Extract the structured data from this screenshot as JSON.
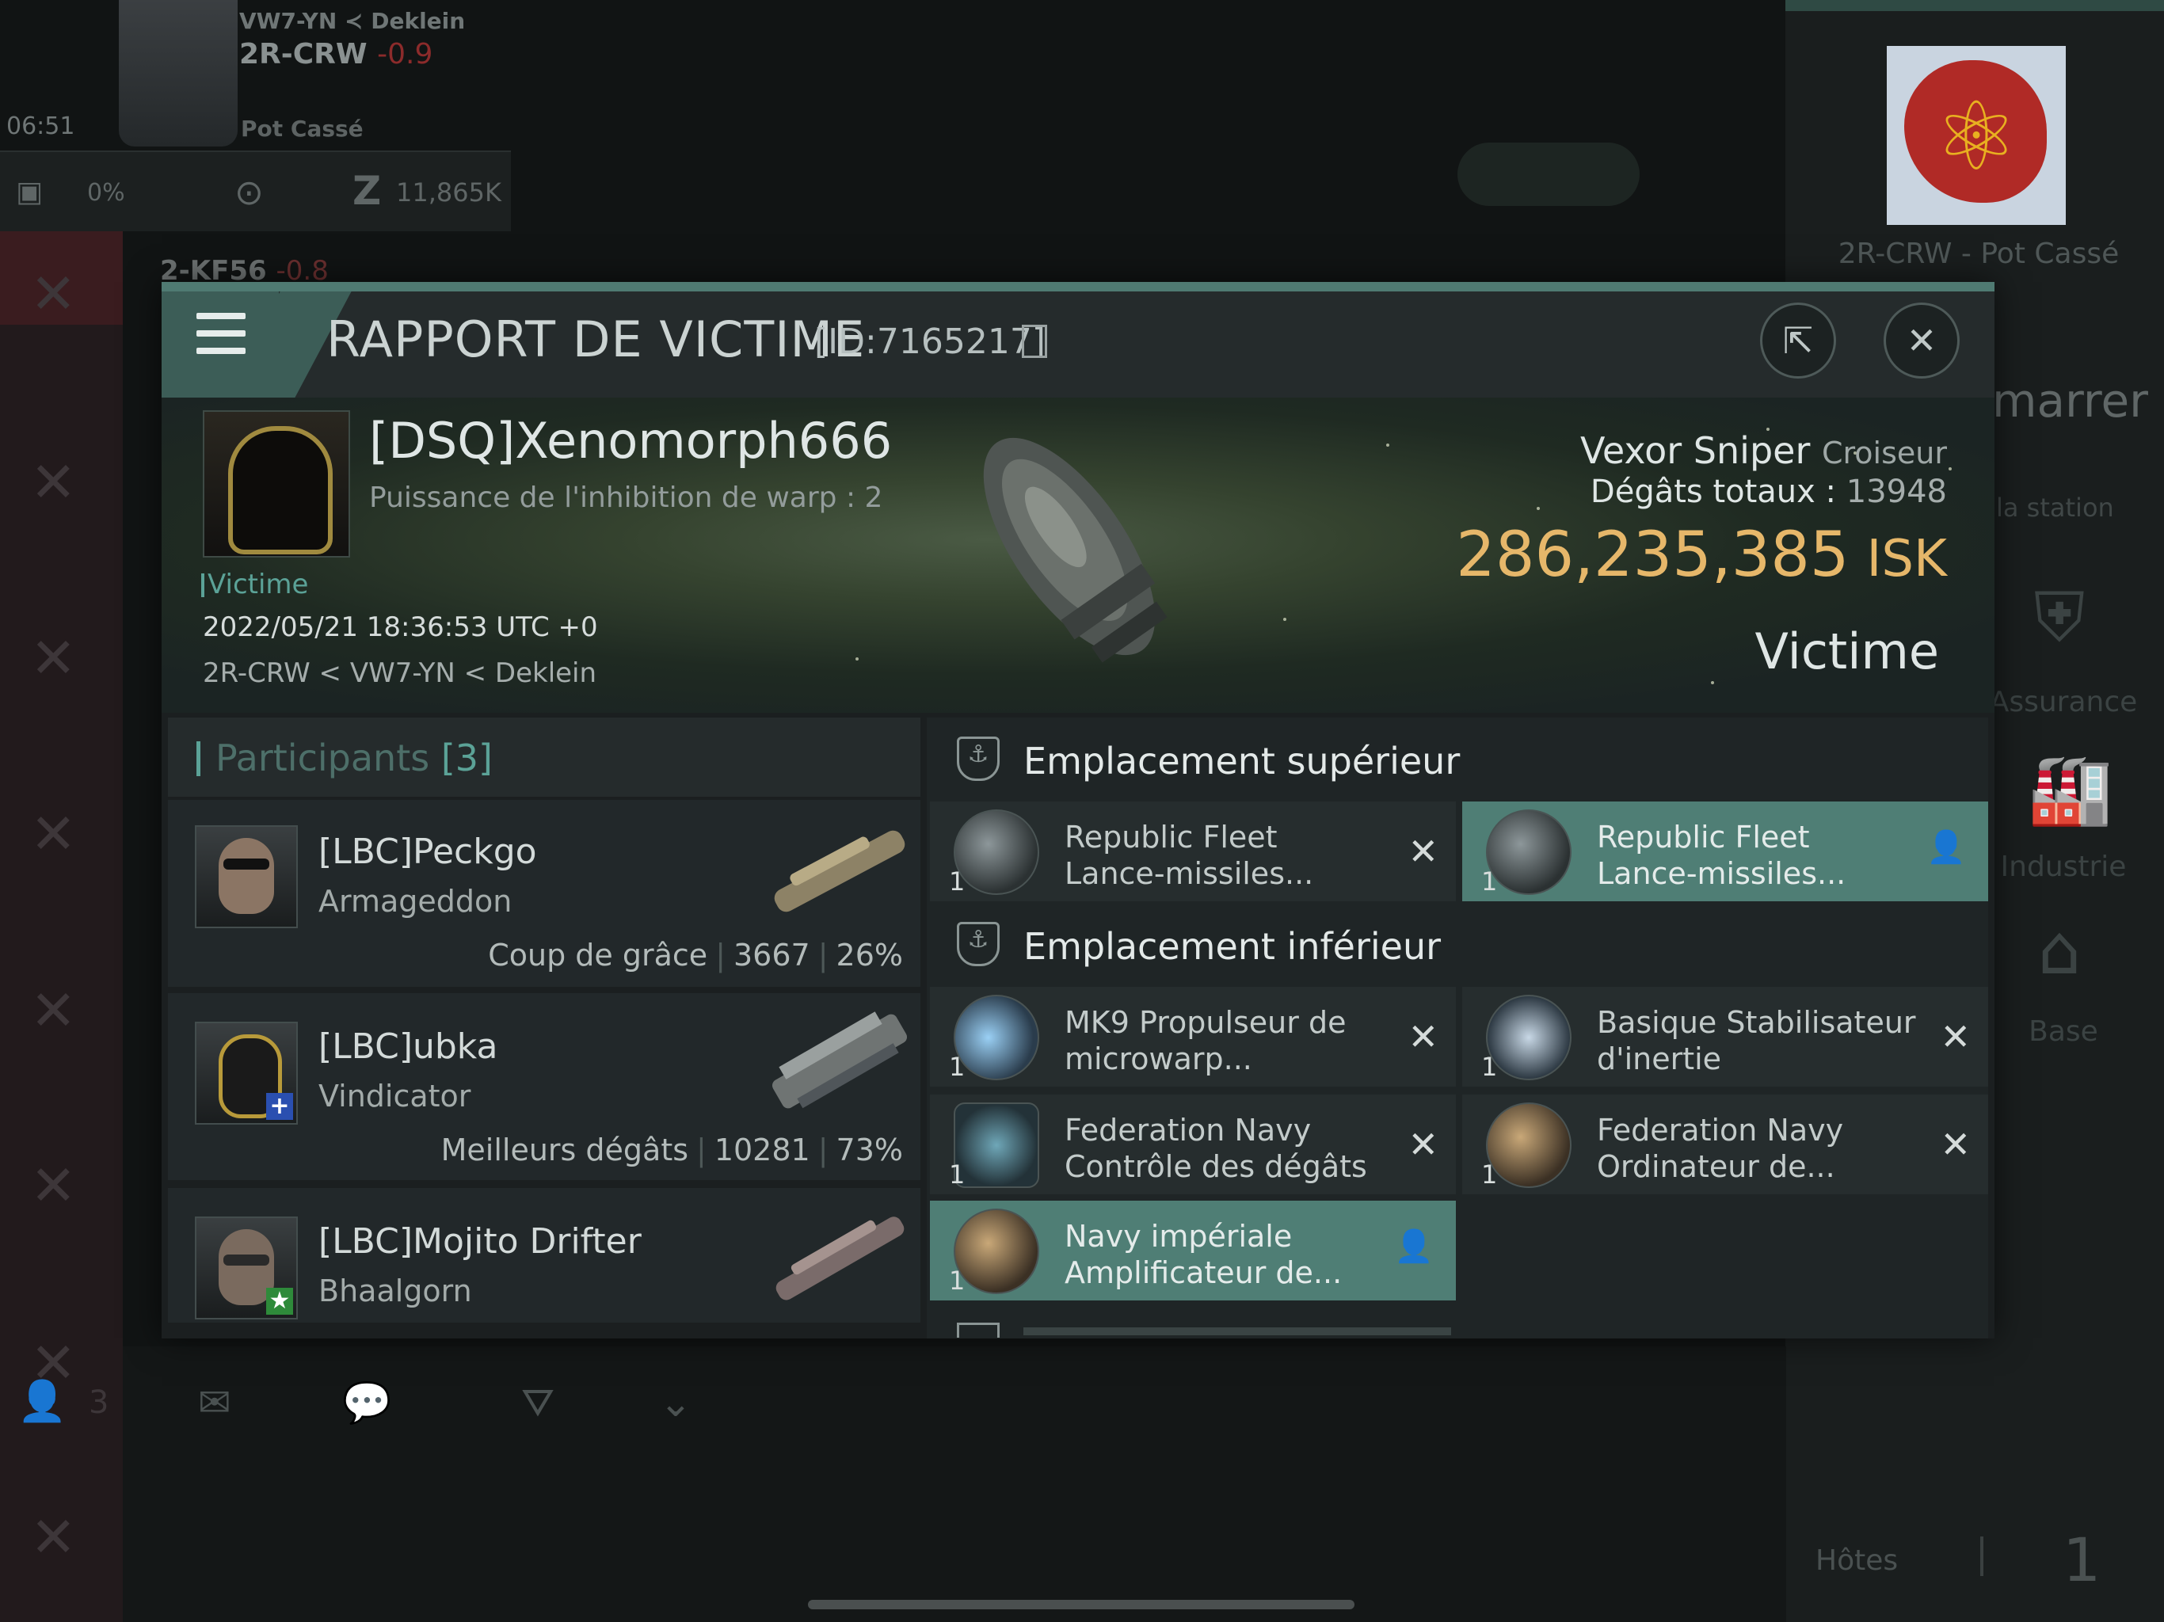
{
  "hud": {
    "system_path": "VW7-YN ≺ Deklein",
    "system": "2R-CRW",
    "security": "-0.9",
    "time": "06:51",
    "corp": "Pot Cassé",
    "cargo_pct": "0%",
    "isk": "11,865K",
    "nearby_system": "2-KF56",
    "nearby_sec": "-0.8",
    "corp_station": "2R-CRW - Pot Cassé",
    "undock_partial": "marrer",
    "station_partial": "la station",
    "services": [
      "Assurance",
      "Industrie",
      "Base"
    ],
    "hosts_label": "Hôtes",
    "hosts_count": "1",
    "left_count": "3"
  },
  "modal": {
    "title": "RAPPORT DE VICTIME",
    "id": "[ID:7165217]",
    "victim": {
      "name": "[DSQ]Xenomorph666",
      "warp": "Puissance de l'inhibition de warp : 2",
      "tag": "Victime",
      "date": "2022/05/21 18:36:53 UTC +0",
      "location": "2R-CRW < VW7-YN < Deklein",
      "ship": "Vexor Sniper",
      "ship_class": "Croiseur",
      "damage_label": "Dégâts totaux :",
      "damage": "13948",
      "isk": "286,235,385",
      "isk_unit": "ISK",
      "role": "Victime"
    },
    "participants": {
      "title": "Participants",
      "count": "[3]",
      "list": [
        {
          "name": "[LBC]Peckgo",
          "ship": "Armageddon",
          "stat_label": "Coup de grâce",
          "damage": "3667",
          "pct": "26%"
        },
        {
          "name": "[LBC]ubka",
          "ship": "Vindicator",
          "stat_label": "Meilleurs dégâts",
          "damage": "10281",
          "pct": "73%"
        },
        {
          "name": "[LBC]Mojito Drifter",
          "ship": "Bhaalgorn"
        }
      ]
    },
    "fitting": {
      "high_title": "Emplacement supérieur",
      "low_title": "Emplacement inférieur",
      "high": [
        {
          "line1": "Republic Fleet",
          "line2": "Lance-missiles...",
          "qty": "1",
          "status": "destroyed"
        },
        {
          "line1": "Republic Fleet",
          "line2": "Lance-missiles...",
          "qty": "1",
          "status": "dropped"
        }
      ],
      "low": [
        {
          "line1": "MK9 Propulseur de",
          "line2": "microwarp...",
          "qty": "1",
          "status": "destroyed"
        },
        {
          "line1": "Basique Stabilisateur",
          "line2": "d'inertie",
          "qty": "1",
          "status": "destroyed"
        },
        {
          "line1": "Federation Navy",
          "line2": "Contrôle des dégâts",
          "qty": "1",
          "status": "destroyed"
        },
        {
          "line1": "Federation Navy",
          "line2": "Ordinateur de...",
          "qty": "1",
          "status": "destroyed"
        },
        {
          "line1": "Navy impériale",
          "line2": "Amplificateur de...",
          "qty": "1",
          "status": "dropped"
        }
      ]
    }
  },
  "colors": {
    "accent": "#5ba297",
    "isk": "#e6b76a",
    "highlight": "#4f7e75"
  }
}
